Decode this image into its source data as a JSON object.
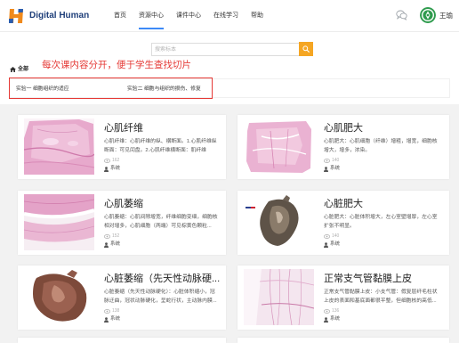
{
  "header": {
    "logo_text": "Digital Human",
    "nav": [
      {
        "label": "首页",
        "active": false
      },
      {
        "label": "资源中心",
        "active": true
      },
      {
        "label": "课件中心",
        "active": false
      },
      {
        "label": "在线学习",
        "active": false
      },
      {
        "label": "帮助",
        "active": false
      }
    ],
    "user_name": "王瑜"
  },
  "search": {
    "placeholder": "搜索标本",
    "value": ""
  },
  "filter": {
    "all_label": "全部",
    "categories": [
      {
        "label": "实验一 细胞组织的适应"
      },
      {
        "label": "实验二 细胞与组织的损伤、修复"
      }
    ]
  },
  "annotation": {
    "text": "每次课内容分开，便于学生查找切片"
  },
  "cards": [
    {
      "title": "心肌纤维",
      "description": "心肌纤维：心肌纤维的纵、横断面。1.心肌纤维纵断面：可见闰盘。2.心肌纤维横断面：肌纤维",
      "views": "162",
      "author": "系统",
      "image": "histology-slide-pink"
    },
    {
      "title": "心肌肥大",
      "description": "心肌肥大：心肌细胞（纤维）增粗，增宽，细胞核增大，增多，浓染。",
      "views": "140",
      "author": "系统",
      "image": "histology-slide-pink"
    },
    {
      "title": "心肌萎缩",
      "description": "心肌萎缩：心肌间隙增宽，纤维细胞变细，细胞核相对增多，心肌细胞（两端）可见棕黄色颗粒...",
      "views": "152",
      "author": "系统",
      "image": "histology-slide-pale"
    },
    {
      "title": "心脏肥大",
      "description": "心脏肥大：心脏体积增大，左心室壁增厚，左心室扩张不明显。",
      "views": "140",
      "author": "系统",
      "image": "gross-heart-specimen"
    },
    {
      "title": "心脏萎缩（先天性动脉硬...",
      "description": "心脏萎缩（先天性动脉硬化）：心脏体积缩小，冠脉迂曲，冠状动脉硬化，呈蛇行状，主动脉内膜...",
      "views": "138",
      "author": "系统",
      "image": "gross-heart-specimen-brown"
    },
    {
      "title": "正常支气管黏膜上皮",
      "description": "正常支气管黏膜上皮：小支气管：假复层纤毛柱状上皮的表面和基底面都很平整，但细胞核的高低...",
      "views": "136",
      "author": "系统",
      "image": "histology-slide-fibers"
    }
  ],
  "icons": {
    "logo": "digital-human-logo",
    "chat": "chat-icon",
    "avatar": "school-emblem-avatar",
    "search": "search-icon",
    "home": "home-icon",
    "views": "eye-icon",
    "author": "user-icon"
  },
  "colors": {
    "accent": "#3d8af7",
    "search_button": "#f5a623",
    "annotation": "#e53935",
    "logo_text": "#1f3f7a",
    "page_bg": "#f2f2f2"
  }
}
